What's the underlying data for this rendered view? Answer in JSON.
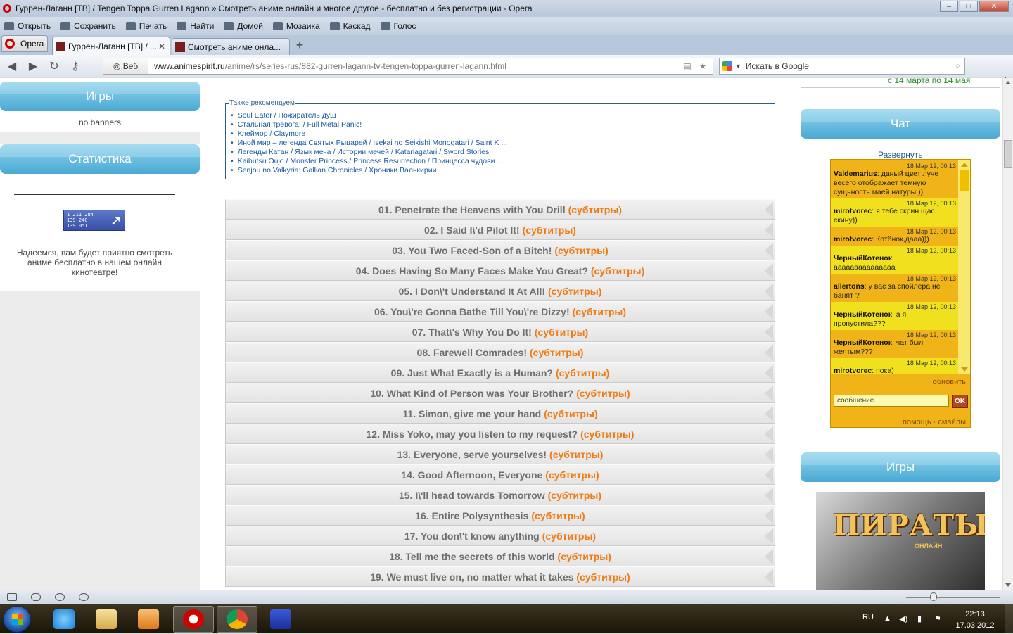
{
  "window": {
    "title": "Гуррен-Лаганн [ТВ] / Tengen Toppa Gurren Lagann » Смотреть аниме онлайн и многое другое - бесплатно и без регистрации - Opera"
  },
  "menu": [
    {
      "label": "Открыть",
      "icon": "folder-icon"
    },
    {
      "label": "Сохранить",
      "icon": "save-icon"
    },
    {
      "label": "Печать",
      "icon": "print-icon"
    },
    {
      "label": "Найти",
      "icon": "search-icon"
    },
    {
      "label": "Домой",
      "icon": "home-icon"
    },
    {
      "label": "Мозаика",
      "icon": "tile-icon"
    },
    {
      "label": "Каскад",
      "icon": "cascade-icon"
    },
    {
      "label": "Голос",
      "icon": "voice-icon"
    }
  ],
  "tabs": {
    "opera_label": "Opera",
    "items": [
      {
        "label": "Гуррен-Лаганн [ТВ] / ...",
        "active": true
      },
      {
        "label": "Смотреть аниме онла...",
        "active": false
      }
    ]
  },
  "address": {
    "mode": "Веб",
    "url_host": "www.animespirit.ru",
    "url_path": "/anime/rs/series-rus/882-gurren-lagann-tv-tengen-toppa-gurren-lagann.html",
    "search_placeholder": "Искать в Google"
  },
  "left": {
    "games_title": "Игры",
    "no_banners": "no banners",
    "stats_title": "Статистика",
    "counter_lines": [
      "1 211 284",
      "139 240",
      "139 051"
    ],
    "hope_text": "Надеемся, вам будет приятно смотреть аниме бесплатно в нашем онлайн кинотеатре!"
  },
  "recommend": {
    "legend": "Также рекомендуем",
    "items": [
      "Soul Eater / Пожиратель душ",
      "Стальная тревога! / Full Metal Panic!",
      "Клеймор / Claymore",
      "Иной мир – легенда Святых Рыцарей / Isekai no Seikishi Monogatari / Saint K ...",
      "Легенды Катан / Язык меча / Истории мечей / Katanagatari / Sword Stories",
      "Kaibutsu Oujo / Monster Princess / Princess Resurrection / Принцесса чудови ...",
      "Senjou no Valkyria: Gallian Chronicles / Хроники Валькирии"
    ]
  },
  "episodes": [
    {
      "title": "01. Penetrate the Heavens with You Drill",
      "sub": "(субтитры)"
    },
    {
      "title": "02. I Said I\\'d Pilot It!",
      "sub": "(субтитры)"
    },
    {
      "title": "03. You Two Faced-Son of a Bitch!",
      "sub": "(субтитры)"
    },
    {
      "title": "04. Does Having So Many Faces Make You Great?",
      "sub": "(субтитры)"
    },
    {
      "title": "05. I Don\\'t Understand It At All!",
      "sub": "(субтитры)"
    },
    {
      "title": "06. You\\'re Gonna Bathe Till You\\'re Dizzy!",
      "sub": "(субтитры)"
    },
    {
      "title": "07. That\\'s Why You Do It!",
      "sub": "(субтитры)"
    },
    {
      "title": "08. Farewell Comrades!",
      "sub": "(субтитры)"
    },
    {
      "title": "09. Just What Exactly is a Human?",
      "sub": "(субтитры)"
    },
    {
      "title": "10. What Kind of Person was Your Brother?",
      "sub": "(субтитры)"
    },
    {
      "title": "11. Simon, give me your hand",
      "sub": "(субтитры)"
    },
    {
      "title": "12. Miss Yoko, may you listen to my request?",
      "sub": "(субтитры)"
    },
    {
      "title": "13. Everyone, serve yourselves!",
      "sub": "(субтитры)"
    },
    {
      "title": "14. Good Afternoon, Everyone",
      "sub": "(субтитры)"
    },
    {
      "title": "15. I\\'ll head towards Tomorrow",
      "sub": "(субтитры)"
    },
    {
      "title": "16. Entire Polysynthesis",
      "sub": "(субтитры)"
    },
    {
      "title": "17. You don\\'t know anything",
      "sub": "(субтитры)"
    },
    {
      "title": "18. Tell me the secrets of this world",
      "sub": "(субтитры)"
    },
    {
      "title": "19. We must live on, no matter what it takes",
      "sub": "(субтитры)"
    }
  ],
  "right": {
    "dates": "с 14 марта по 14 мая",
    "chat_title": "Чат",
    "expand": "Развернуть",
    "messages": [
      {
        "time": "18 Мар 12, 00:13",
        "user": "Valdemarius",
        "text": ": даный цвет луче весего отображает темную сущьность маей натуры ))"
      },
      {
        "time": "18 Мар 12, 00:13",
        "user": "mirotvorec",
        "text": ": я тебе скрин щас скину))"
      },
      {
        "time": "18 Мар 12, 00:13",
        "user": "mirotvorec",
        "text": ": Котёнок,дааа)))"
      },
      {
        "time": "18 Мар 12, 00:13",
        "user": "ЧерныйКотенок",
        "text": ": ааааааааааааааа"
      },
      {
        "time": "18 Мар 12, 00:13",
        "user": "allertons",
        "text": ": у вас за спойлера не банят ?"
      },
      {
        "time": "18 Мар 12, 00:13",
        "user": "ЧерныйКотенок",
        "text": ": а я пропустила???"
      },
      {
        "time": "18 Мар 12, 00:13",
        "user": "ЧерныйКотенок",
        "text": ": чат был желтым???"
      },
      {
        "time": "18 Мар 12, 00:13",
        "user": "mirotvorec",
        "text": ": пока)"
      }
    ],
    "refresh": "обновить",
    "message_placeholder": "сообщение",
    "ok": "OK",
    "help": "помощь · смайлы",
    "games_title": "Игры",
    "game_logo": "ПИРАТЫ",
    "game_sub": "ОНЛАЙН"
  },
  "taskbar": {
    "lang": "RU",
    "time": "22:13",
    "date": "17.03.2012"
  }
}
